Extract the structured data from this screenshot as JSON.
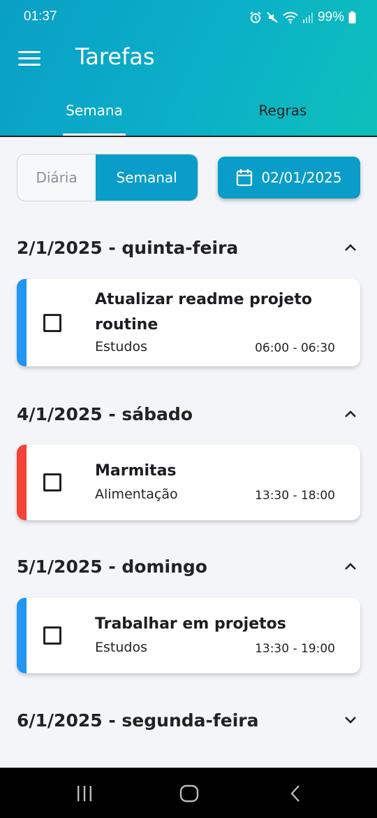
{
  "status": {
    "time": "01:37",
    "battery": "99%"
  },
  "appbar": {
    "title": "Tarefas"
  },
  "tabs": [
    {
      "label": "Semana",
      "active": true
    },
    {
      "label": "Regras",
      "active": false
    }
  ],
  "view_toggle": {
    "options": [
      "Diária",
      "Semanal"
    ],
    "selected": "Semanal"
  },
  "date_picker": {
    "value": "02/01/2025"
  },
  "days": [
    {
      "title": "2/1/2025 - quinta-feira",
      "expanded": true,
      "tasks": [
        {
          "title": "Atualizar readme projeto routine",
          "category": "Estudos",
          "time": "06:00 - 06:30",
          "color": "#2196f3"
        }
      ]
    },
    {
      "title": "4/1/2025 - sábado",
      "expanded": true,
      "tasks": [
        {
          "title": "Marmitas",
          "category": "Alimentação",
          "time": "13:30 - 18:00",
          "color": "#f44336"
        }
      ]
    },
    {
      "title": "5/1/2025 - domingo",
      "expanded": true,
      "tasks": [
        {
          "title": "Trabalhar em projetos",
          "category": "Estudos",
          "time": "13:30 - 19:00",
          "color": "#2196f3"
        }
      ]
    },
    {
      "title": "6/1/2025 - segunda-feira",
      "expanded": false,
      "tasks": []
    }
  ],
  "colors": {
    "accent": "#0a9dc9",
    "header_start": "#0a9fc6",
    "header_end": "#0cc0bb"
  }
}
